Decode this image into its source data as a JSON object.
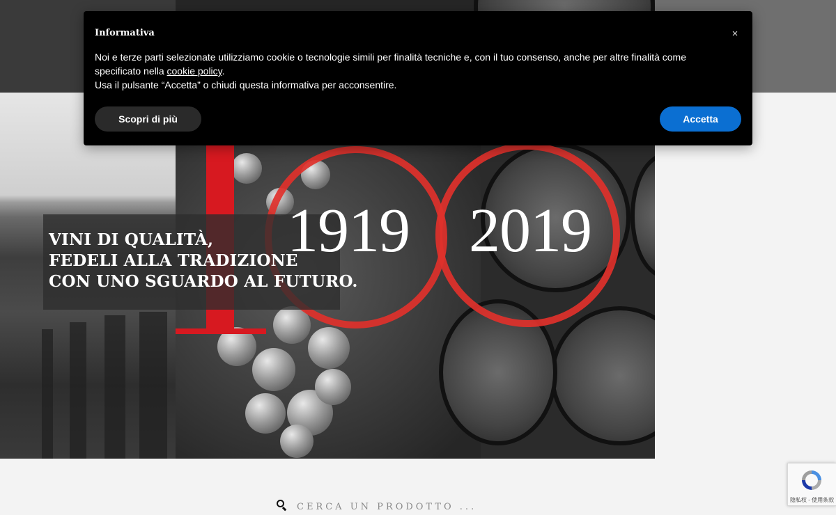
{
  "cookie_banner": {
    "title": "Informativa",
    "close_symbol": "×",
    "line1": "Noi e terze parti selezionate utilizziamo cookie o tecnologie simili per finalità tecniche e, con il tuo consenso, anche per altre finalità come",
    "line2_prefix": "specificato nella ",
    "policy_link": "cookie policy",
    "line2_suffix": ".",
    "line3": "Usa il pulsante “Accetta” o chiudi questa informativa per acconsentire.",
    "learn_more_label": "Scopri di più",
    "accept_label": "Accetta"
  },
  "hero": {
    "tagline": [
      "VINI DI QUALITÀ,",
      "FEDELI ALLA TRADIZIONE",
      "CON UNO SGUARDO AL FUTURO."
    ],
    "year_start": "1919",
    "year_end": "2019"
  },
  "search": {
    "placeholder": "CERCA UN PRODOTTO ..."
  },
  "recaptcha": {
    "text": "隐私权 - 使用条款"
  },
  "colors": {
    "accent_red": "#d71920",
    "accept_blue": "#0b6fd2",
    "banner_bg": "#000000"
  }
}
